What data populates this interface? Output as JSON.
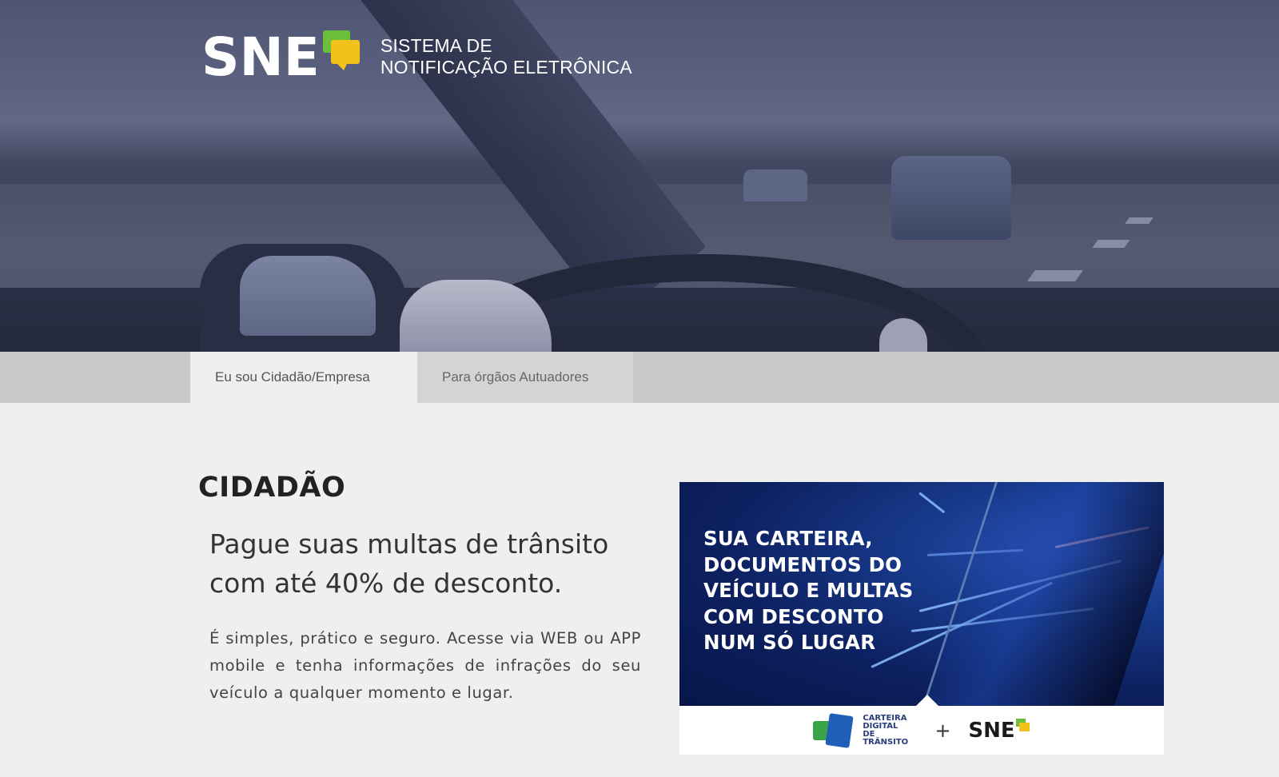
{
  "brand": {
    "logo_text": "SNE",
    "tagline_line1": "SISTEMA DE",
    "tagline_line2": "NOTIFICAÇÃO ELETRÔNICA",
    "colors": {
      "bubble_green": "#6cbf3a",
      "bubble_yellow": "#f2c21b"
    }
  },
  "tabs": [
    {
      "label": "Eu sou Cidadão/Empresa",
      "active": true
    },
    {
      "label": "Para órgãos Autuadores",
      "active": false
    }
  ],
  "content": {
    "section_title": "CIDADÃO",
    "headline": "Pague suas multas de trânsito com até 40% de desconto.",
    "body": "É simples, prático e seguro. Acesse via WEB ou APP mobile e tenha informações de infrações do seu veículo a qualquer momento e lugar."
  },
  "banner": {
    "headline_lines": [
      "SUA CARTEIRA,",
      "DOCUMENTOS DO",
      "VEÍCULO E MULTAS",
      "COM DESCONTO",
      "NUM SÓ LUGAR"
    ],
    "cdt_line1": "CARTEIRA",
    "cdt_line2": "DIGITAL DE",
    "cdt_line3": "TRÂNSITO",
    "plus": "+",
    "sne_logo_text": "SNE"
  }
}
